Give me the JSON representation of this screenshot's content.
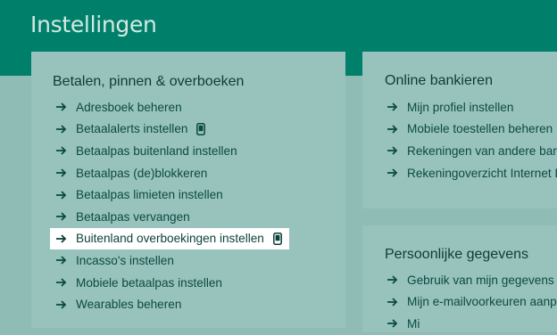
{
  "page": {
    "title": "Instellingen"
  },
  "left": {
    "title": "Betalen, pinnen & overboeken",
    "items": [
      {
        "label": "Adresboek beheren"
      },
      {
        "label": "Betaalalerts instellen"
      },
      {
        "label": "Betaalpas buitenland instellen"
      },
      {
        "label": "Betaalpas (de)blokkeren"
      },
      {
        "label": "Betaalpas limieten instellen"
      },
      {
        "label": "Betaalpas vervangen"
      },
      {
        "label": "Buitenland overboekingen instellen"
      },
      {
        "label": "Incasso's instellen"
      },
      {
        "label": "Mobiele betaalpas instellen"
      },
      {
        "label": "Wearables beheren"
      }
    ]
  },
  "online": {
    "title": "Online bankieren",
    "items": [
      {
        "label": "Mijn profiel instellen"
      },
      {
        "label": "Mobiele toestellen beheren"
      },
      {
        "label": "Rekeningen van andere banken"
      },
      {
        "label": "Rekeningoverzicht Internet Ban"
      }
    ]
  },
  "personal": {
    "title": "Persoonlijke gegevens",
    "items": [
      {
        "label": "Gebruik van mijn gegevens aan"
      },
      {
        "label": "Mijn e-mailvoorkeuren aanpass"
      },
      {
        "label": "Mi"
      }
    ]
  },
  "icons": {
    "arrow": "arrow-right-icon",
    "mobile": "mobile-phone-icon"
  },
  "colors": {
    "header": "#00806b",
    "background": "#8fbcb5",
    "card": "#98c3bd",
    "link": "#0b4a41",
    "highlight": "#ffffff"
  }
}
